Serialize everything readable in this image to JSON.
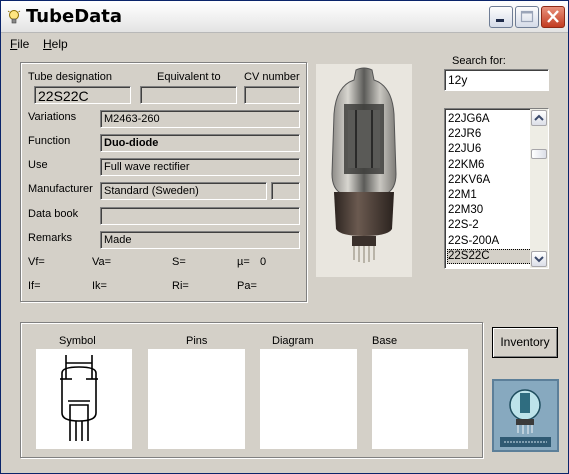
{
  "window": {
    "title": "TubeData"
  },
  "menu": [
    {
      "label": "File",
      "acc": "F",
      "rest": "ile"
    },
    {
      "label": "Help",
      "acc": "H",
      "rest": "elp"
    }
  ],
  "tube": {
    "designation_label": "Tube designation",
    "equivalent_label": "Equivalent to",
    "cv_label": "CV number",
    "designation": "22S22C",
    "equivalent": "",
    "cv": "",
    "variations_label": "Variations",
    "variations": "M2463-260",
    "function_label": "Function",
    "function": "Duo-diode",
    "use_label": "Use",
    "use": "Full wave rectifier",
    "manufacturer_label": "Manufacturer",
    "manufacturer": "Standard (Sweden)",
    "manufacturer_extra": "",
    "databook_label": "Data book",
    "databook": "",
    "remarks_label": "Remarks",
    "remarks": "Made"
  },
  "params": {
    "vf": "Vf=",
    "va": "Va=",
    "s": "S=",
    "mu": "µ=",
    "mu_value": "0",
    "if": "If=",
    "ik": "Ik=",
    "ri": "Ri=",
    "pa": "Pa="
  },
  "search": {
    "label": "Search for:",
    "value": "12y",
    "items": [
      "22JG6A",
      "22JR6",
      "22JU6",
      "22KM6",
      "22KV6A",
      "22M1",
      "22M30",
      "22S-2",
      "22S-200A",
      "22S22C"
    ],
    "selected_index": 9
  },
  "bottom": {
    "symbol_label": "Symbol",
    "pins_label": "Pins",
    "diagram_label": "Diagram",
    "base_label": "Base"
  },
  "inventory_button": "Inventory",
  "colors": {
    "title_close": "#c23b21",
    "panel_bg": "#d4d0c8"
  }
}
